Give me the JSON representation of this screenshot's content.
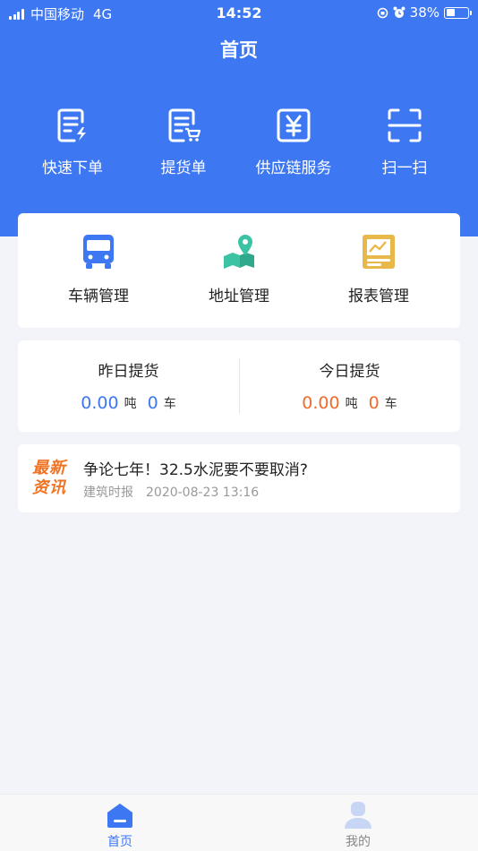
{
  "status_bar": {
    "carrier": "中国移动",
    "network": "4G",
    "time": "14:52",
    "battery_percent": "38%"
  },
  "header": {
    "title": "首页"
  },
  "quick_actions": [
    {
      "label": "快速下单",
      "icon": "quick-order-icon"
    },
    {
      "label": "提货单",
      "icon": "pickup-cart-icon"
    },
    {
      "label": "供应链服务",
      "icon": "yen-icon"
    },
    {
      "label": "扫一扫",
      "icon": "scan-icon"
    }
  ],
  "management": [
    {
      "label": "车辆管理",
      "icon": "truck-icon"
    },
    {
      "label": "地址管理",
      "icon": "map-pin-icon"
    },
    {
      "label": "报表管理",
      "icon": "report-icon"
    }
  ],
  "stats": {
    "yesterday": {
      "title": "昨日提货",
      "tons": "0.00",
      "ton_unit": "吨",
      "trucks": "0",
      "truck_unit": "车"
    },
    "today": {
      "title": "今日提货",
      "tons": "0.00",
      "ton_unit": "吨",
      "trucks": "0",
      "truck_unit": "车"
    }
  },
  "news": {
    "badge_line1": "最新",
    "badge_line2": "资讯",
    "title": "争论七年！32.5水泥要不要取消?",
    "source": "建筑时报",
    "datetime": "2020-08-23 13:16"
  },
  "tabbar": {
    "home_label": "首页",
    "mine_label": "我的"
  },
  "colors": {
    "primary": "#3d78f2",
    "orange": "#ef6c2b",
    "teal": "#3cc3a4",
    "gold": "#e9b84a"
  }
}
